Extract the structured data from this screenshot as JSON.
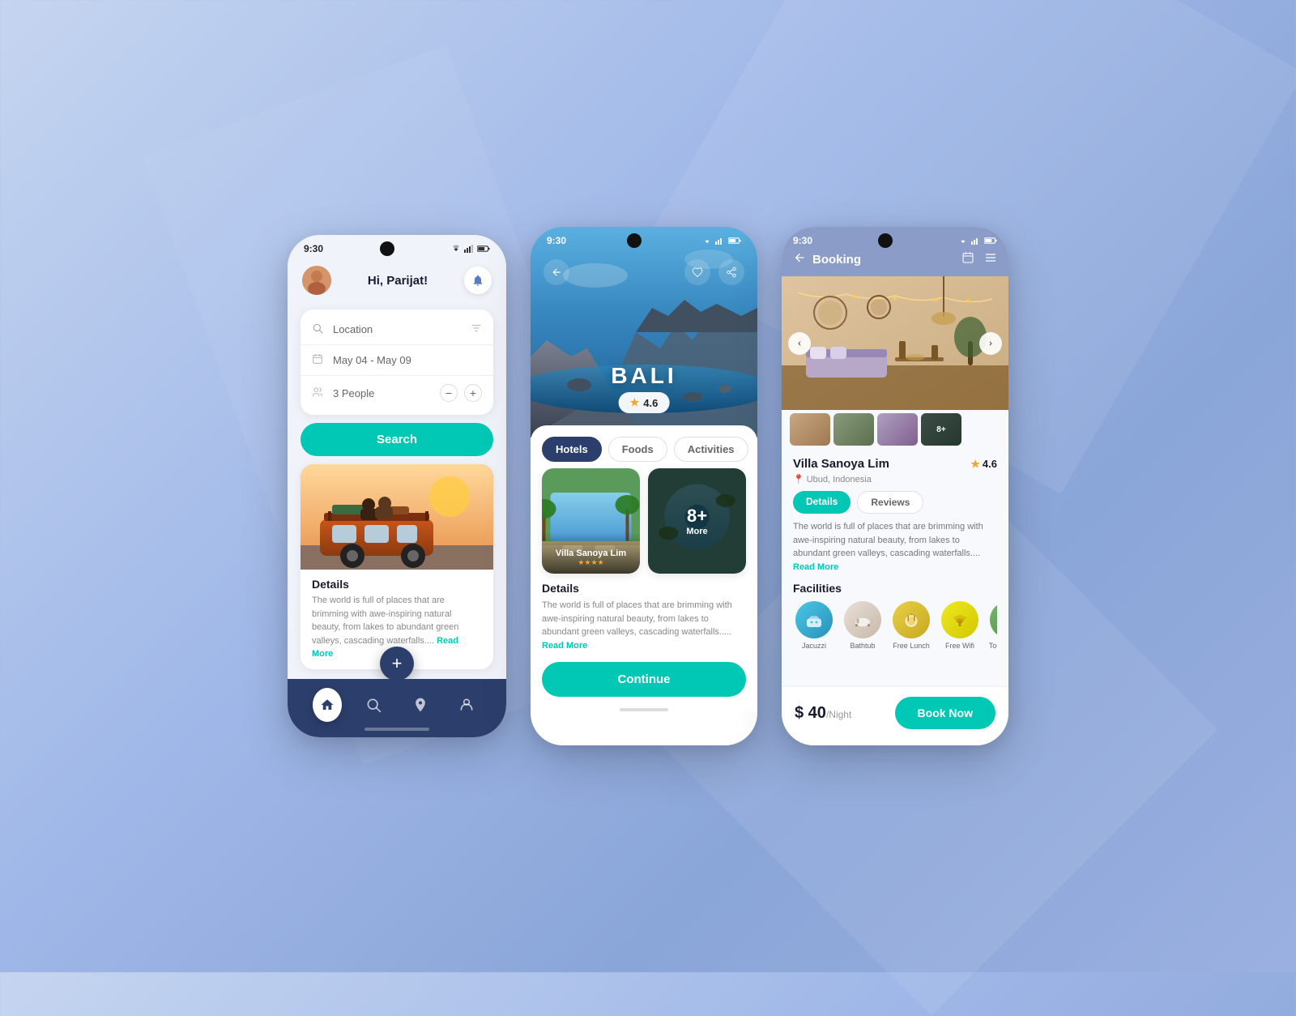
{
  "background": {
    "gradient": "linear-gradient(135deg, #c5d5f0 0%, #a0b8e8 40%, #8aa5d8 70%, #9ab0e0 100%)"
  },
  "phone1": {
    "status_time": "9:30",
    "greeting": "Hi, Parijat!",
    "location_label": "Location",
    "date_label": "May 04 - May 09",
    "people_label": "3 People",
    "search_button": "Search",
    "card_title": "Details",
    "card_desc": "The world is full of places that are brimming with awe-inspiring natural beauty, from lakes to abundant green valleys, cascading waterfalls....",
    "read_more": "Read More",
    "nav_items": [
      "home",
      "search",
      "location",
      "profile"
    ]
  },
  "phone2": {
    "status_time": "9:30",
    "destination": "BALI",
    "rating": "4.6",
    "tabs": [
      "Hotels",
      "Foods",
      "Activities"
    ],
    "active_tab": "Hotels",
    "card1_name": "Villa Sanoya Lim",
    "card1_stars": "★★★★",
    "more_count": "8+",
    "more_label": "More",
    "details_title": "Details",
    "details_desc": "The world is full of places that are brimming with awe-inspiring natural beauty, from lakes to abundant green valleys, cascading waterfalls.....",
    "read_more": "Read More",
    "continue_button": "Continue"
  },
  "phone3": {
    "status_time": "9:30",
    "header_title": "Booking",
    "villa_name": "Villa Sanoya Lim",
    "rating": "4.6",
    "location": "Ubud, Indonesia",
    "tabs": [
      "Details",
      "Reviews"
    ],
    "active_tab": "Details",
    "description": "The world is full of places that are brimming with awe-inspiring natural beauty, from lakes to abundant green valleys, cascading waterfalls....",
    "read_more": "Read More",
    "facilities_title": "Facilities",
    "facilities": [
      {
        "name": "Jacuzzi",
        "icon": "🏊"
      },
      {
        "name": "Bathtub",
        "icon": "🛁"
      },
      {
        "name": "Free Lunch",
        "icon": "🍽"
      },
      {
        "name": "Free Wifi",
        "icon": "📶"
      },
      {
        "name": "Tour Around",
        "icon": "🌿"
      }
    ],
    "price": "$ 40",
    "price_unit": "/Night",
    "book_button": "Book Now",
    "photo_more": "8+"
  }
}
